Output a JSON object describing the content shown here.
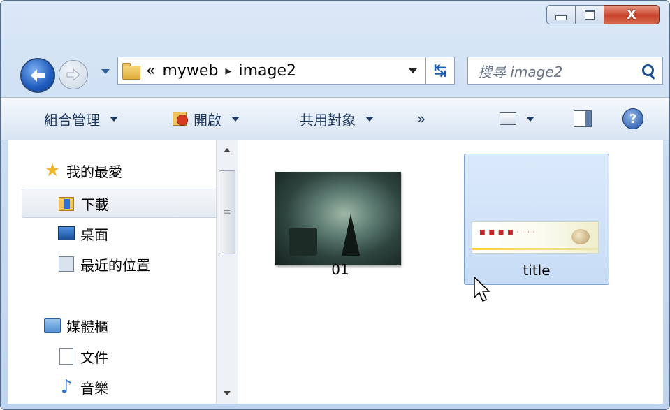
{
  "window": {
    "caption": {
      "close_glyph": "X"
    }
  },
  "address": {
    "overflow": "«",
    "crumbs": [
      "myweb",
      "image2"
    ],
    "separator": "▸"
  },
  "search": {
    "placeholder": "搜尋 image2"
  },
  "toolbar": {
    "organize": "組合管理",
    "open": "開啟",
    "share": "共用對象",
    "more": "»"
  },
  "navpane": {
    "favorites": "我的最愛",
    "downloads": "下載",
    "desktop": "桌面",
    "recent": "最近的位置",
    "libraries": "媒體櫃",
    "documents": "文件",
    "music": "音樂"
  },
  "files": [
    {
      "name": "01",
      "selected": false
    },
    {
      "name": "title",
      "selected": true
    }
  ],
  "colors": {
    "selection": "#cfe1f8",
    "accent": "#1d5fb4"
  }
}
